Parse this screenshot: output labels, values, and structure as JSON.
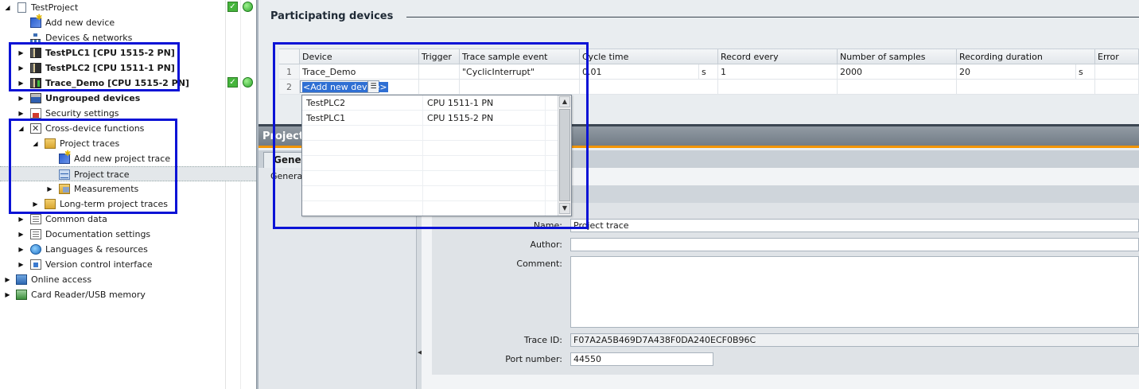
{
  "tree": {
    "items": [
      {
        "label": "TestProject",
        "icon": "project-icon",
        "bold": false
      },
      {
        "label": "Add new device",
        "icon": "add-device-icon",
        "bold": false
      },
      {
        "label": "Devices & networks",
        "icon": "network-icon",
        "bold": false
      },
      {
        "label": "TestPLC1 [CPU 1515-2 PN]",
        "icon": "plc-icon",
        "bold": true
      },
      {
        "label": "TestPLC2 [CPU 1511-1 PN]",
        "icon": "plc-icon",
        "bold": true
      },
      {
        "label": "Trace_Demo [CPU 1515-2 PN]",
        "icon": "plc-online-icon",
        "bold": true
      },
      {
        "label": "Ungrouped devices",
        "icon": "ungrouped-icon",
        "bold": true
      },
      {
        "label": "Security settings",
        "icon": "security-icon",
        "bold": false
      },
      {
        "label": "Cross-device functions",
        "icon": "cross-device-icon",
        "bold": false
      },
      {
        "label": "Project traces",
        "icon": "folder-icon",
        "bold": false
      },
      {
        "label": "Add new project trace",
        "icon": "add-trace-icon",
        "bold": false
      },
      {
        "label": "Project trace",
        "icon": "trace-icon",
        "bold": false
      },
      {
        "label": "Measurements",
        "icon": "measurements-icon",
        "bold": false
      },
      {
        "label": "Long-term project traces",
        "icon": "folder-icon",
        "bold": false
      },
      {
        "label": "Common data",
        "icon": "common-data-icon",
        "bold": false
      },
      {
        "label": "Documentation settings",
        "icon": "documentation-icon",
        "bold": false
      },
      {
        "label": "Languages & resources",
        "icon": "globe-icon",
        "bold": false
      },
      {
        "label": "Version control interface",
        "icon": "version-control-icon",
        "bold": false
      },
      {
        "label": "Online access",
        "icon": "online-access-icon",
        "bold": false
      },
      {
        "label": "Card Reader/USB memory",
        "icon": "card-reader-icon",
        "bold": false
      }
    ]
  },
  "participating": {
    "title": "Participating devices",
    "columns": [
      "Device",
      "Trigger",
      "Trace sample event",
      "Cycle time",
      "Record every",
      "Number of samples",
      "Recording duration",
      "Error"
    ],
    "rows": [
      {
        "num": "1",
        "device": "Trace_Demo",
        "trigger": "",
        "event": "\"CyclicInterrupt\"",
        "cycle": "0.01",
        "cycle_unit": "s",
        "record": "1",
        "samples": "2000",
        "duration": "20",
        "duration_unit": "s",
        "error": ""
      },
      {
        "num": "2",
        "device": "<Add new device>"
      }
    ],
    "dropdown": [
      {
        "name": "TestPLC2",
        "cpu": "CPU 1511-1 PN"
      },
      {
        "name": "TestPLC1",
        "cpu": "CPU 1515-2 PN"
      }
    ]
  },
  "inspector": {
    "title": "Project",
    "tab": "General",
    "nav_item": "General",
    "fields": {
      "name_label": "Name:",
      "name_value": "Project trace",
      "author_label": "Author:",
      "author_value": "",
      "comment_label": "Comment:",
      "comment_value": "",
      "traceid_label": "Trace ID:",
      "traceid_value": "F07A2A5B469D7A438F0DA240ECF0B96C",
      "port_label": "Port number:",
      "port_value": "44550"
    }
  },
  "colors": {
    "highlight": "#0b13d6",
    "accent": "#f29400",
    "status_ok": "#46b53c"
  }
}
